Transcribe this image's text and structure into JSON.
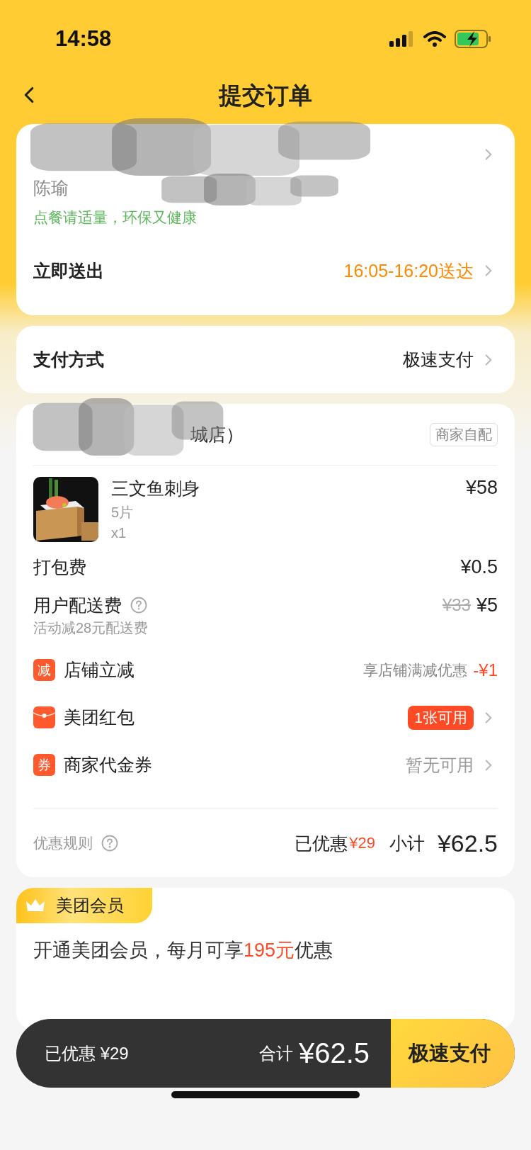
{
  "status_bar": {
    "time": "14:58"
  },
  "nav": {
    "title": "提交订单"
  },
  "address_card": {
    "contact": "陈瑜",
    "tip": "点餐请适量，环保又健康",
    "delivery": {
      "label": "立即送出",
      "time": "16:05-16:20送达"
    }
  },
  "payment": {
    "label": "支付方式",
    "value": "极速支付"
  },
  "order": {
    "store_name": "城店）",
    "delivery_tag": "商家自配",
    "items": [
      {
        "name": "三文鱼刺身",
        "spec": "5片",
        "qty": "x1",
        "price": "¥58"
      }
    ],
    "fees": [
      {
        "label": "打包费",
        "price": "¥0.5",
        "has_help": false
      },
      {
        "label": "用户配送费",
        "has_help": true,
        "original": "¥33",
        "price": "¥5",
        "note": "活动减28元配送费"
      }
    ],
    "promos": [
      {
        "kind": "text_badge",
        "badge": "减",
        "label": "店铺立减",
        "hint": "享店铺满减优惠",
        "amount": "-¥1",
        "arrow": false
      },
      {
        "kind": "red_packet",
        "label": "美团红包",
        "tag": "1张可用",
        "arrow": true
      },
      {
        "kind": "text_badge",
        "badge": "券",
        "label": "商家代金券",
        "hint": "暂无可用",
        "arrow": true
      }
    ],
    "summary": {
      "rules": "优惠规则",
      "saved_label": "已优惠",
      "saved": "¥29",
      "subtotal_label": "小计",
      "subtotal": "¥62.5"
    }
  },
  "member": {
    "badge": "美团会员",
    "before": "开通美团会员，每月可享",
    "highlight": "195元",
    "after": "优惠"
  },
  "checkout": {
    "saved": "已优惠 ¥29",
    "total_label": "合计",
    "total": "¥62.5",
    "button": "极速支付"
  }
}
